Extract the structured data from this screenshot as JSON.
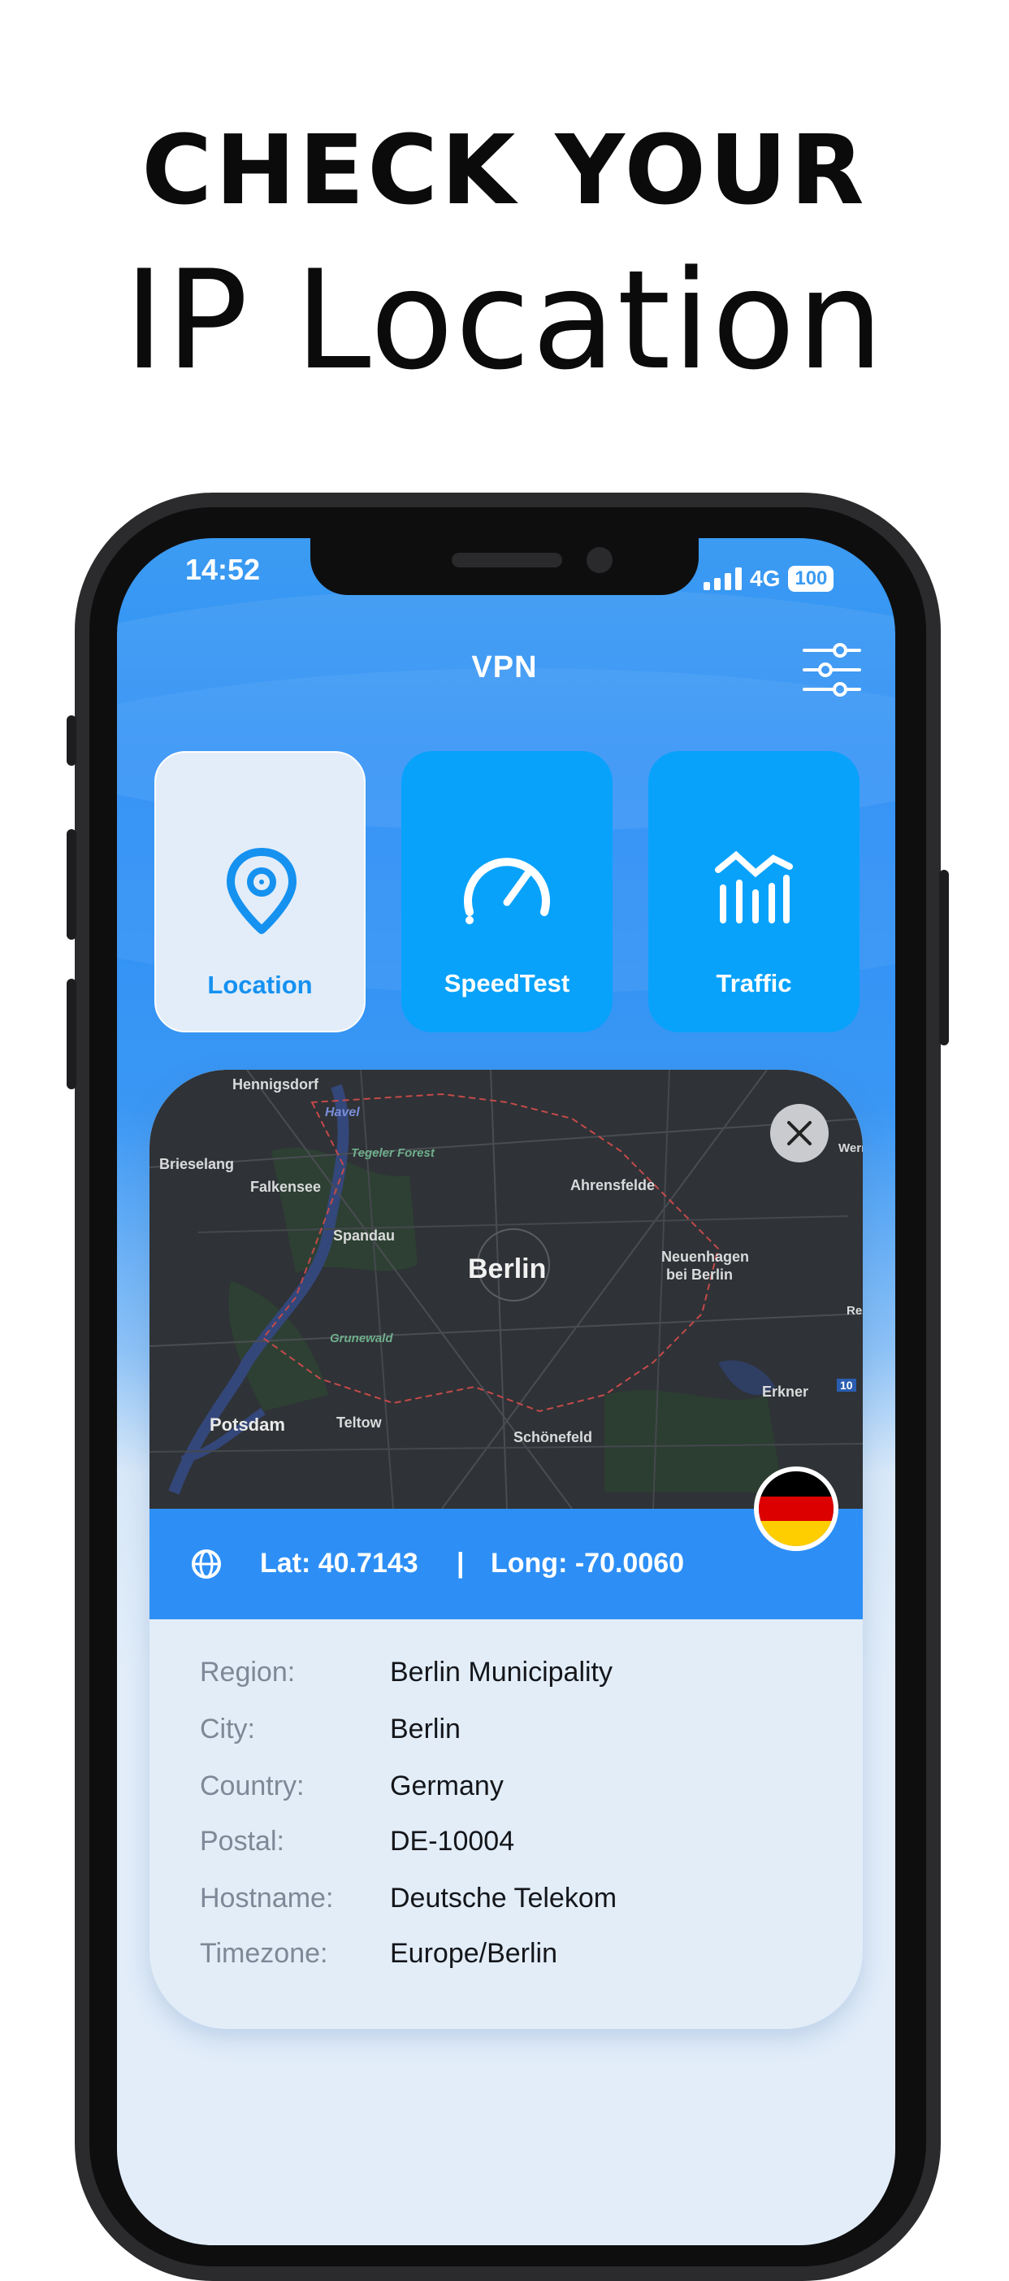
{
  "promo": {
    "line1": "CHECK YOUR",
    "line2": "IP Location"
  },
  "status_bar": {
    "time": "14:52",
    "network": "4G",
    "battery": "100"
  },
  "header": {
    "title": "VPN",
    "settings_icon": "sliders-icon"
  },
  "tiles": [
    {
      "label": "Location",
      "icon": "location-pin-icon",
      "active": true
    },
    {
      "label": "SpeedTest",
      "icon": "speedometer-icon",
      "active": false
    },
    {
      "label": "Traffic",
      "icon": "traffic-chart-icon",
      "active": false
    }
  ],
  "map": {
    "labels": {
      "hennigsdorf": "Hennigsdorf",
      "havel": "Havel",
      "tegeler_forest": "Tegeler Forest",
      "brieselang": "Brieselang",
      "falkensee": "Falkensee",
      "ahrensfelde": "Ahrensfelde",
      "spandau": "Spandau",
      "berlin": "Berlin",
      "neuenhagen": "Neuenhagen",
      "bei_berlin": "bei Berlin",
      "grunewald": "Grunewald",
      "erkner": "Erkner",
      "potsdam": "Potsdam",
      "teltow": "Teltow",
      "schonefeld": "Schönefeld",
      "road_10": "10",
      "werneu": "Werneu",
      "re": "Re"
    },
    "close_icon": "close-icon"
  },
  "coordinates": {
    "lat": "Lat: 40.7143",
    "separator": "|",
    "long": "Long: -70.0060",
    "globe_icon": "globe-icon",
    "flag": "germany-flag"
  },
  "details": [
    {
      "key": "Region:",
      "value": "Berlin Municipality"
    },
    {
      "key": "City:",
      "value": "Berlin"
    },
    {
      "key": "Country:",
      "value": "Germany"
    },
    {
      "key": "Postal:",
      "value": "DE-10004"
    },
    {
      "key": "Hostname:",
      "value": "Deutsche Telekom"
    },
    {
      "key": "Timezone:",
      "value": "Europe/Berlin"
    }
  ],
  "colors": {
    "primary_blue": "#2d8ff6",
    "tile_blue": "#08a2fb",
    "card_bg": "#e2edf8",
    "active_label": "#1591f0"
  }
}
